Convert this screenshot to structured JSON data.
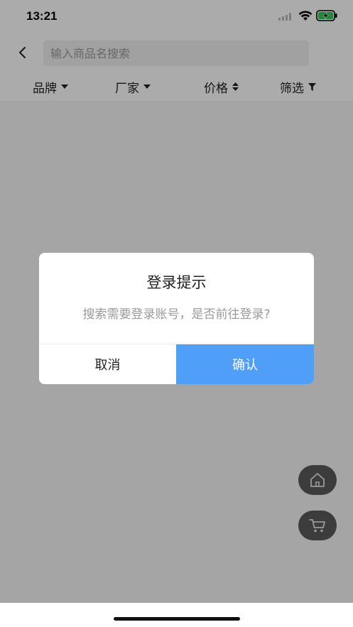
{
  "colors": {
    "accent": "#4f9ef8",
    "overlay": "rgba(0,0,0,0.33)",
    "fab": "#5a5a5a"
  },
  "status_bar": {
    "time": "13:21",
    "icons": [
      "signal-icon",
      "wifi-icon",
      "battery-charging-icon"
    ]
  },
  "header": {
    "back_icon": "chevron-left-icon",
    "search": {
      "placeholder": "输入商品名搜索",
      "value": ""
    }
  },
  "filters": [
    {
      "label": "品牌",
      "icon": "caret-down-icon"
    },
    {
      "label": "厂家",
      "icon": "caret-down-icon"
    },
    {
      "label": "价格",
      "icon": "sort-icon"
    },
    {
      "label": "筛选",
      "icon": "filter-icon"
    }
  ],
  "floating_buttons": [
    {
      "icon": "home-icon"
    },
    {
      "icon": "cart-icon"
    }
  ],
  "dialog": {
    "title": "登录提示",
    "message": "搜索需要登录账号，是否前往登录?",
    "cancel_label": "取消",
    "confirm_label": "确认"
  }
}
